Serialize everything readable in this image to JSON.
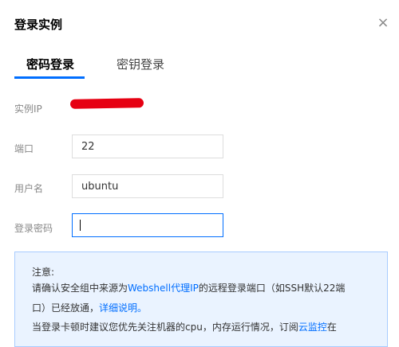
{
  "dialog": {
    "title": "登录实例",
    "close_symbol": "×"
  },
  "tabs": [
    {
      "label": "密码登录",
      "active": true
    },
    {
      "label": "密钥登录",
      "active": false
    }
  ],
  "form": {
    "ip_label": "实例IP",
    "port_label": "端口",
    "port_value": "22",
    "username_label": "用户名",
    "username_value": "ubuntu",
    "password_label": "登录密码",
    "password_value": ""
  },
  "notice": {
    "heading": "注意:",
    "line1_a": "请确认安全组中来源为",
    "line1_link": "Webshell代理IP",
    "line1_b": "的远程登录端口（如SSH默认22端",
    "line2_a": "口）已经放通，",
    "line2_link": "详细说明。",
    "line3_a": "当登录卡顿时建议您优先关注机器的cpu，内存运行情况，订阅",
    "line3_link": "云监控",
    "line3_b": "在"
  },
  "colors": {
    "accent": "#006eff",
    "notice_bg": "#eaf3ff",
    "notice_border": "#a8ccff",
    "redaction": "#e60012"
  }
}
